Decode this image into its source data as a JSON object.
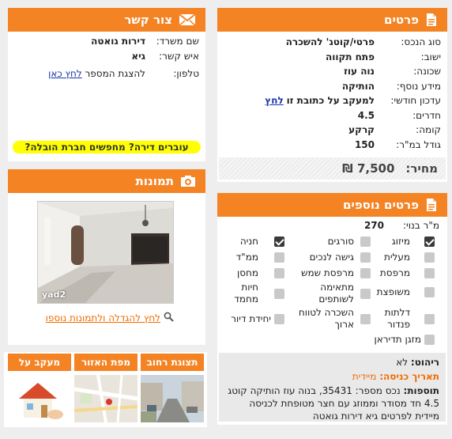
{
  "details": {
    "title": "פרטים",
    "rows": [
      {
        "label": "סוג הנכס:",
        "value": "פרטי/קוטג' להשכרה"
      },
      {
        "label": "ישוב:",
        "value": "פתח תקווה"
      },
      {
        "label": "שכונה:",
        "value": "נוה עוז"
      },
      {
        "label": "מידע נוסף:",
        "value": "הותיקה"
      },
      {
        "label": "עדכון חודשי:",
        "value": "למעקב על כתובת זו",
        "link": "לחץ"
      },
      {
        "label": "חדרים:",
        "value": "4.5"
      },
      {
        "label": "קומה:",
        "value": "קרקע"
      },
      {
        "label": "גודל במ\"ר:",
        "value": "150"
      }
    ],
    "price_label": "מחיר:",
    "price_value": "7,500 ₪"
  },
  "contact": {
    "title": "צור קשר",
    "office_label": "שם משרד:",
    "office_value": "דירות גואטה",
    "person_label": "איש קשר:",
    "person_value": "גיא",
    "phone_label": "טלפון:",
    "phone_text": "להצגת המספר",
    "phone_link": "לחץ כאן",
    "banner": "עוברים דירה? מחפשים חברת הובלה?"
  },
  "photos": {
    "title": "תמונות",
    "watermark": "yad2",
    "link": "לחץ להגדלה ולתמונות נוספו"
  },
  "tiles": [
    {
      "label": "תצוגת רחוב"
    },
    {
      "label": "מפת האזור"
    },
    {
      "label": "מעקב על הנכס"
    }
  ],
  "extra": {
    "title": "פרטים נוספים",
    "built_label": "מ\"ר בנוי:",
    "built_value": "270",
    "features": [
      {
        "label": "מיזוג",
        "checked": true
      },
      {
        "label": "סורגים",
        "checked": false
      },
      {
        "label": "חניה",
        "checked": true
      },
      {
        "label": "מעלית",
        "checked": false
      },
      {
        "label": "גישה לנכים",
        "checked": false
      },
      {
        "label": "ממ\"ד",
        "checked": false
      },
      {
        "label": "מרפסת",
        "checked": false
      },
      {
        "label": "מרפסת שמש",
        "checked": false
      },
      {
        "label": "מחסן",
        "checked": false
      },
      {
        "label": "משופצת",
        "checked": false
      },
      {
        "label": "מתאימה לשותפים",
        "checked": false
      },
      {
        "label": "חיות מחמד",
        "checked": false
      },
      {
        "label": "דלתות פנדור",
        "checked": false
      },
      {
        "label": "השכרה לטווח ארוך",
        "checked": false
      },
      {
        "label": "יחידת דיור",
        "checked": false
      },
      {
        "label": "מזגן תדיראן",
        "checked": false
      }
    ],
    "furniture_label": "ריהוט:",
    "furniture_value": "לא",
    "entry_label": "תאריך כניסה:",
    "entry_value": "מיידית",
    "notes_label": "תוספות:",
    "notes_text": "נכס מספר: 35431, בנוה עוז הותיקה קוטג 4.5 חד מסודר וממוזג עם חצר מטופחת לכניסה מיידית לפרטים גיא דירות גואטה"
  }
}
